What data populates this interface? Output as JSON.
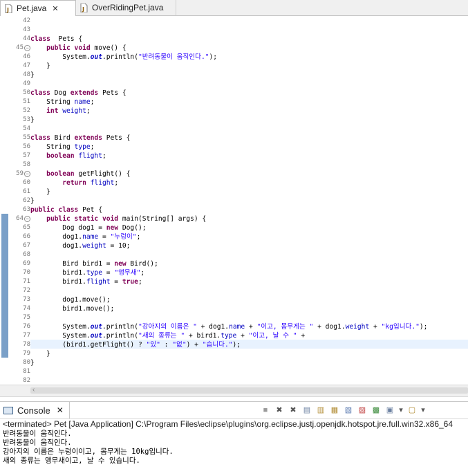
{
  "tabs": [
    {
      "label": "Pet.java",
      "active": true,
      "closable": true
    },
    {
      "label": "OverRidingPet.java",
      "active": false,
      "closable": false
    }
  ],
  "editor": {
    "lines": [
      {
        "n": "42",
        "text": []
      },
      {
        "n": "43",
        "text": []
      },
      {
        "n": "44",
        "text": [
          [
            "kw",
            "class"
          ],
          [
            "",
            "  Pets {"
          ]
        ]
      },
      {
        "n": "45",
        "fold": true,
        "text": [
          [
            "",
            "    "
          ],
          [
            "kw",
            "public"
          ],
          [
            "",
            " "
          ],
          [
            "kw",
            "void"
          ],
          [
            "",
            " move() {"
          ]
        ]
      },
      {
        "n": "46",
        "text": [
          [
            "",
            "        System."
          ],
          [
            "stat",
            "out"
          ],
          [
            "",
            ".println("
          ],
          [
            "str",
            "\"반려동물이 움직인다.\""
          ],
          [
            "",
            ");"
          ]
        ]
      },
      {
        "n": "47",
        "text": [
          [
            "",
            "    }"
          ]
        ]
      },
      {
        "n": "48",
        "text": [
          [
            "",
            "}"
          ]
        ]
      },
      {
        "n": "49",
        "text": []
      },
      {
        "n": "50",
        "text": [
          [
            "kw",
            "class"
          ],
          [
            "",
            " Dog "
          ],
          [
            "kw",
            "extends"
          ],
          [
            "",
            " Pets {"
          ]
        ]
      },
      {
        "n": "51",
        "text": [
          [
            "",
            "    String "
          ],
          [
            "fld",
            "name"
          ],
          [
            "",
            ";"
          ]
        ]
      },
      {
        "n": "52",
        "text": [
          [
            "",
            "    "
          ],
          [
            "kw",
            "int"
          ],
          [
            "",
            " "
          ],
          [
            "fld",
            "weight"
          ],
          [
            "",
            ";"
          ]
        ]
      },
      {
        "n": "53",
        "text": [
          [
            "",
            "}"
          ]
        ]
      },
      {
        "n": "54",
        "text": []
      },
      {
        "n": "55",
        "text": [
          [
            "kw",
            "class"
          ],
          [
            "",
            " Bird "
          ],
          [
            "kw",
            "extends"
          ],
          [
            "",
            " Pets {"
          ]
        ]
      },
      {
        "n": "56",
        "text": [
          [
            "",
            "    String "
          ],
          [
            "fld",
            "type"
          ],
          [
            "",
            ";"
          ]
        ]
      },
      {
        "n": "57",
        "text": [
          [
            "",
            "    "
          ],
          [
            "kw",
            "boolean"
          ],
          [
            "",
            " "
          ],
          [
            "fld",
            "flight"
          ],
          [
            "",
            ";"
          ]
        ]
      },
      {
        "n": "58",
        "text": []
      },
      {
        "n": "59",
        "fold": true,
        "text": [
          [
            "",
            "    "
          ],
          [
            "kw",
            "boolean"
          ],
          [
            "",
            " getFlight() {"
          ]
        ]
      },
      {
        "n": "60",
        "text": [
          [
            "",
            "        "
          ],
          [
            "kw",
            "return"
          ],
          [
            "",
            " "
          ],
          [
            "fld",
            "flight"
          ],
          [
            "",
            ";"
          ]
        ]
      },
      {
        "n": "61",
        "text": [
          [
            "",
            "    }"
          ]
        ]
      },
      {
        "n": "62",
        "text": [
          [
            "",
            "}"
          ]
        ]
      },
      {
        "n": "63",
        "text": [
          [
            "kw",
            "public"
          ],
          [
            "",
            " "
          ],
          [
            "kw",
            "class"
          ],
          [
            "",
            " Pet {"
          ]
        ]
      },
      {
        "n": "64",
        "fold": true,
        "text": [
          [
            "",
            "    "
          ],
          [
            "kw",
            "public"
          ],
          [
            "",
            " "
          ],
          [
            "kw",
            "static"
          ],
          [
            "",
            " "
          ],
          [
            "kw",
            "void"
          ],
          [
            "",
            " main(String[] args) {"
          ]
        ]
      },
      {
        "n": "65",
        "text": [
          [
            "",
            "        Dog dog1 = "
          ],
          [
            "kw",
            "new"
          ],
          [
            "",
            " Dog();"
          ]
        ]
      },
      {
        "n": "66",
        "text": [
          [
            "",
            "        dog1."
          ],
          [
            "fld",
            "name"
          ],
          [
            "",
            " = "
          ],
          [
            "str",
            "\"누렁이\""
          ],
          [
            "",
            ";"
          ]
        ]
      },
      {
        "n": "67",
        "text": [
          [
            "",
            "        dog1."
          ],
          [
            "fld",
            "weight"
          ],
          [
            "",
            " = 10;"
          ]
        ]
      },
      {
        "n": "68",
        "text": []
      },
      {
        "n": "69",
        "text": [
          [
            "",
            "        Bird bird1 = "
          ],
          [
            "kw",
            "new"
          ],
          [
            "",
            " Bird();"
          ]
        ]
      },
      {
        "n": "70",
        "text": [
          [
            "",
            "        bird1."
          ],
          [
            "fld",
            "type"
          ],
          [
            "",
            " = "
          ],
          [
            "str",
            "\"앵무새\""
          ],
          [
            "",
            ";"
          ]
        ]
      },
      {
        "n": "71",
        "text": [
          [
            "",
            "        bird1."
          ],
          [
            "fld",
            "flight"
          ],
          [
            "",
            " = "
          ],
          [
            "kw",
            "true"
          ],
          [
            "",
            ";"
          ]
        ]
      },
      {
        "n": "72",
        "text": []
      },
      {
        "n": "73",
        "text": [
          [
            "",
            "        dog1.move();"
          ]
        ]
      },
      {
        "n": "74",
        "text": [
          [
            "",
            "        bird1.move();"
          ]
        ]
      },
      {
        "n": "75",
        "text": []
      },
      {
        "n": "76",
        "text": [
          [
            "",
            "        System."
          ],
          [
            "stat",
            "out"
          ],
          [
            "",
            ".println("
          ],
          [
            "str",
            "\"강아지의 이름은 \""
          ],
          [
            "",
            " + dog1."
          ],
          [
            "fld",
            "name"
          ],
          [
            "",
            " + "
          ],
          [
            "str",
            "\"이고, 몸무게는 \""
          ],
          [
            "",
            " + dog1."
          ],
          [
            "fld",
            "weight"
          ],
          [
            "",
            " + "
          ],
          [
            "str",
            "\"kg입니다.\""
          ],
          [
            "",
            ");"
          ]
        ]
      },
      {
        "n": "77",
        "text": [
          [
            "",
            "        System."
          ],
          [
            "stat",
            "out"
          ],
          [
            "",
            ".println("
          ],
          [
            "str",
            "\"새의 종류는 \""
          ],
          [
            "",
            " + bird1."
          ],
          [
            "fld",
            "type"
          ],
          [
            "",
            " + "
          ],
          [
            "str",
            "\"이고, 날 수 \""
          ],
          [
            "",
            " +"
          ]
        ]
      },
      {
        "n": "78",
        "text": [
          [
            "",
            "        (bird1.getFlight() ? "
          ],
          [
            "str",
            "\"있\""
          ],
          [
            "",
            " : "
          ],
          [
            "str",
            "\"없\""
          ],
          [
            "",
            ") + "
          ],
          [
            "str",
            "\"습니다.\""
          ],
          [
            "",
            ");"
          ]
        ]
      },
      {
        "n": "79",
        "text": [
          [
            "",
            "    }"
          ]
        ]
      },
      {
        "n": "80",
        "text": [
          [
            "",
            "}"
          ]
        ]
      },
      {
        "n": "81",
        "text": []
      },
      {
        "n": "82",
        "text": []
      }
    ],
    "current_line": "78"
  },
  "console": {
    "tab_label": "Console",
    "terminated_text": "<terminated> Pet [Java Application] C:\\Program Files\\eclipse\\plugins\\org.eclipse.justj.openjdk.hotspot.jre.full.win32.x86_64",
    "output": [
      "반려동물이 움직인다.",
      "반려동물이 움직인다.",
      "강아지의 이름은 누렁이이고, 몸무게는 10kg입니다.",
      "새의 종류는 앵무새이고, 날 수 있습니다."
    ],
    "toolbar_icons": [
      "terminate-icon",
      "remove-launch-icon",
      "remove-all-terminated-icon",
      "clear-console-icon",
      "scroll-lock-icon",
      "word-wrap-icon",
      "show-on-stdout-icon",
      "show-on-stderr-icon",
      "pin-console-icon",
      "display-console-icon",
      "dropdown-icon",
      "open-console-icon",
      "dropdown-icon"
    ]
  },
  "colors": {
    "keyword": "#7f0055",
    "string": "#2a00ff",
    "field": "#0000c0",
    "current_line": "#e8f2fe"
  }
}
